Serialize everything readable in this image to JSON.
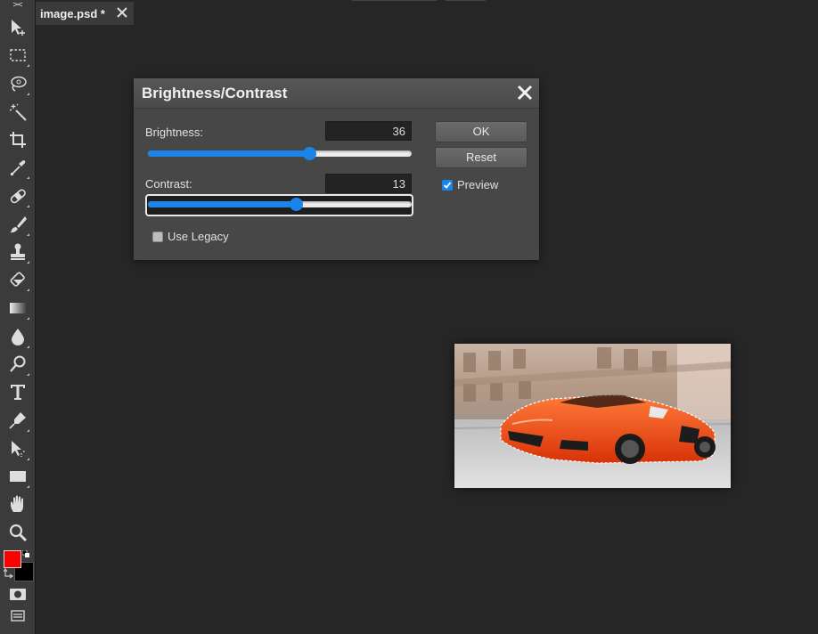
{
  "app": {
    "collapse_label": "><",
    "tab": {
      "title": "image.psd *"
    }
  },
  "toolbar": {
    "tools": [
      {
        "name": "move-tool",
        "icon": "move-icon"
      },
      {
        "name": "marquee-tool",
        "icon": "rect-select-icon"
      },
      {
        "name": "lasso-tool",
        "icon": "lasso-icon"
      },
      {
        "name": "magic-wand-tool",
        "icon": "magic-wand-icon"
      },
      {
        "name": "crop-tool",
        "icon": "crop-icon"
      },
      {
        "name": "eyedropper-tool",
        "icon": "eyedropper-icon"
      },
      {
        "name": "healing-tool",
        "icon": "bandage-icon"
      },
      {
        "name": "brush-tool",
        "icon": "brush-icon"
      },
      {
        "name": "clone-stamp-tool",
        "icon": "stamp-icon"
      },
      {
        "name": "eraser-tool",
        "icon": "eraser-icon"
      },
      {
        "name": "gradient-tool",
        "icon": "gradient-icon"
      },
      {
        "name": "blur-tool",
        "icon": "drop-icon"
      },
      {
        "name": "dodge-tool",
        "icon": "dodge-icon"
      },
      {
        "name": "type-tool",
        "icon": "type-icon"
      },
      {
        "name": "pen-tool",
        "icon": "pen-icon"
      },
      {
        "name": "path-select-tool",
        "icon": "path-select-icon"
      },
      {
        "name": "shape-tool",
        "icon": "rectangle-icon"
      },
      {
        "name": "hand-tool",
        "icon": "hand-icon"
      },
      {
        "name": "zoom-tool",
        "icon": "magnifier-icon"
      }
    ],
    "foreground_color": "#ff0000",
    "background_color": "#000000"
  },
  "dialog": {
    "title": "Brightness/Contrast",
    "brightness": {
      "label": "Brightness:",
      "value": "36",
      "slider_fraction": 0.61
    },
    "contrast": {
      "label": "Contrast:",
      "value": "13",
      "slider_fraction": 0.56
    },
    "use_legacy": {
      "label": "Use Legacy",
      "checked": false
    },
    "ok_label": "OK",
    "reset_label": "Reset",
    "preview": {
      "label": "Preview",
      "checked": true
    }
  },
  "colors": {
    "accent": "#1a84e8",
    "car_body": "#e8400e"
  }
}
